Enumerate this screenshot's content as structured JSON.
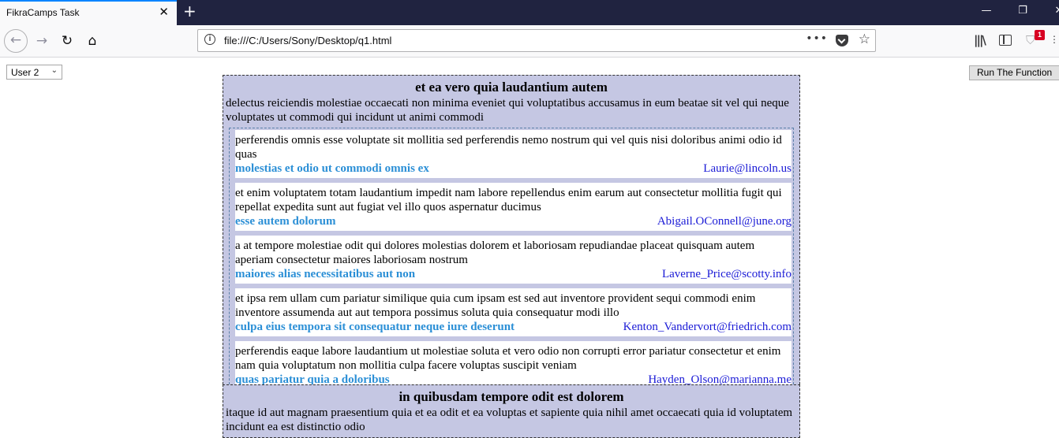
{
  "browser": {
    "tab_title": "FikraCamps Task",
    "tab_close": "✕",
    "new_tab": "+",
    "url": "file:///C:/Users/Sony/Desktop/q1.html",
    "url_more": "•••",
    "shield_badge": "1",
    "window_controls": {
      "minimize": "—",
      "restore": "❐",
      "close": "✕"
    }
  },
  "controls": {
    "user_select_value": "User 2",
    "run_button_label": "Run The Function"
  },
  "posts": [
    {
      "title": "et ea vero quia laudantium autem",
      "body": "delectus reiciendis molestiae occaecati non minima eveniet qui voluptatibus accusamus in eum beatae sit vel qui neque voluptates ut commodi qui incidunt ut animi commodi",
      "comments": [
        {
          "body": "perferendis omnis esse voluptate sit mollitia sed perferendis nemo nostrum qui vel quis nisi doloribus animi odio id quas",
          "name": "molestias et odio ut commodi omnis ex",
          "email": "Laurie@lincoln.us"
        },
        {
          "body": "et enim voluptatem totam laudantium impedit nam labore repellendus enim earum aut consectetur mollitia fugit qui repellat expedita sunt aut fugiat vel illo quos aspernatur ducimus",
          "name": "esse autem dolorum",
          "email": "Abigail.OConnell@june.org"
        },
        {
          "body": "a at tempore molestiae odit qui dolores molestias dolorem et laboriosam repudiandae placeat quisquam autem aperiam consectetur maiores laboriosam nostrum",
          "name": "maiores alias necessitatibus aut non",
          "email": "Laverne_Price@scotty.info"
        },
        {
          "body": "et ipsa rem ullam cum pariatur similique quia cum ipsam est sed aut inventore provident sequi commodi enim inventore assumenda aut aut tempora possimus soluta quia consequatur modi illo",
          "name": "culpa eius tempora sit consequatur neque iure deserunt",
          "email": "Kenton_Vandervort@friedrich.com"
        },
        {
          "body": "perferendis eaque labore laudantium ut molestiae soluta et vero odio non corrupti error pariatur consectetur et enim nam quia voluptatum non mollitia culpa facere voluptas suscipit veniam",
          "name": "quas pariatur quia a doloribus",
          "email": "Hayden_Olson@marianna.me"
        }
      ]
    },
    {
      "title": "in quibusdam tempore odit est dolorem",
      "body": "itaque id aut magnam praesentium quia et ea odit et ea voluptas et sapiente quia nihil amet occaecati quia id voluptatem incidunt ea est distinctio odio"
    }
  ]
}
